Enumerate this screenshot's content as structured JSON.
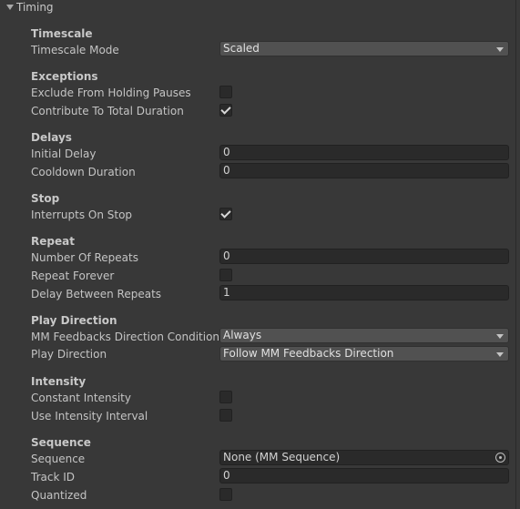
{
  "foldout": {
    "title": "Timing"
  },
  "timescale": {
    "header": "Timescale",
    "mode_label": "Timescale Mode",
    "mode_value": "Scaled"
  },
  "exceptions": {
    "header": "Exceptions",
    "exclude_label": "Exclude From Holding Pauses",
    "exclude_checked": false,
    "contribute_label": "Contribute To Total Duration",
    "contribute_checked": true
  },
  "delays": {
    "header": "Delays",
    "initial_label": "Initial Delay",
    "initial_value": "0",
    "cooldown_label": "Cooldown Duration",
    "cooldown_value": "0"
  },
  "stop": {
    "header": "Stop",
    "interrupts_label": "Interrupts On Stop",
    "interrupts_checked": true
  },
  "repeat": {
    "header": "Repeat",
    "number_label": "Number Of Repeats",
    "number_value": "0",
    "forever_label": "Repeat Forever",
    "forever_checked": false,
    "delay_label": "Delay Between Repeats",
    "delay_value": "1"
  },
  "play_direction": {
    "header": "Play Direction",
    "condition_label": "MM Feedbacks Direction Condition",
    "condition_value": "Always",
    "direction_label": "Play Direction",
    "direction_value": "Follow MM Feedbacks Direction"
  },
  "intensity": {
    "header": "Intensity",
    "constant_label": "Constant Intensity",
    "constant_checked": false,
    "interval_label": "Use Intensity Interval",
    "interval_checked": false
  },
  "sequence": {
    "header": "Sequence",
    "sequence_label": "Sequence",
    "sequence_value": "None (MM Sequence)",
    "track_label": "Track ID",
    "track_value": "0",
    "quantized_label": "Quantized",
    "quantized_checked": false
  }
}
